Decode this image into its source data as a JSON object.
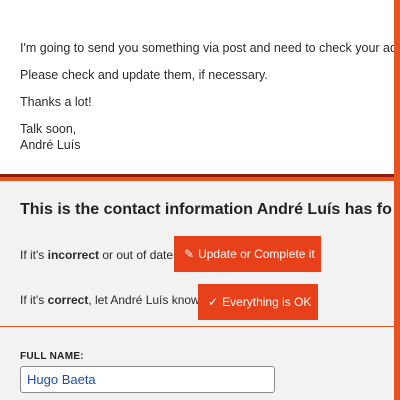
{
  "email": {
    "line1": "I'm going to send you something via post and need to check your address",
    "line2": "Please check and update them, if necessary.",
    "line3": "Thanks a lot!",
    "signoff": "Talk soon,",
    "signature": "André Luís"
  },
  "form": {
    "heading": "This is the contact information André Luís has fo",
    "incorrect_prefix": "If it's ",
    "incorrect_bold": "incorrect",
    "incorrect_suffix": " or out of date:",
    "update_icon": "✎",
    "update_label": "Update or Complete it",
    "correct_prefix": "If it's ",
    "correct_bold": "correct",
    "correct_suffix": ", let André Luís know:",
    "ok_icon": "✓",
    "ok_label": "Everything is OK",
    "full_name_label": "FULL NAME:",
    "full_name_value": "Hugo Baeta"
  },
  "colors": {
    "accent": "#e6411a",
    "frame": "#e6531f",
    "divider_dark": "#8e1d0b"
  }
}
